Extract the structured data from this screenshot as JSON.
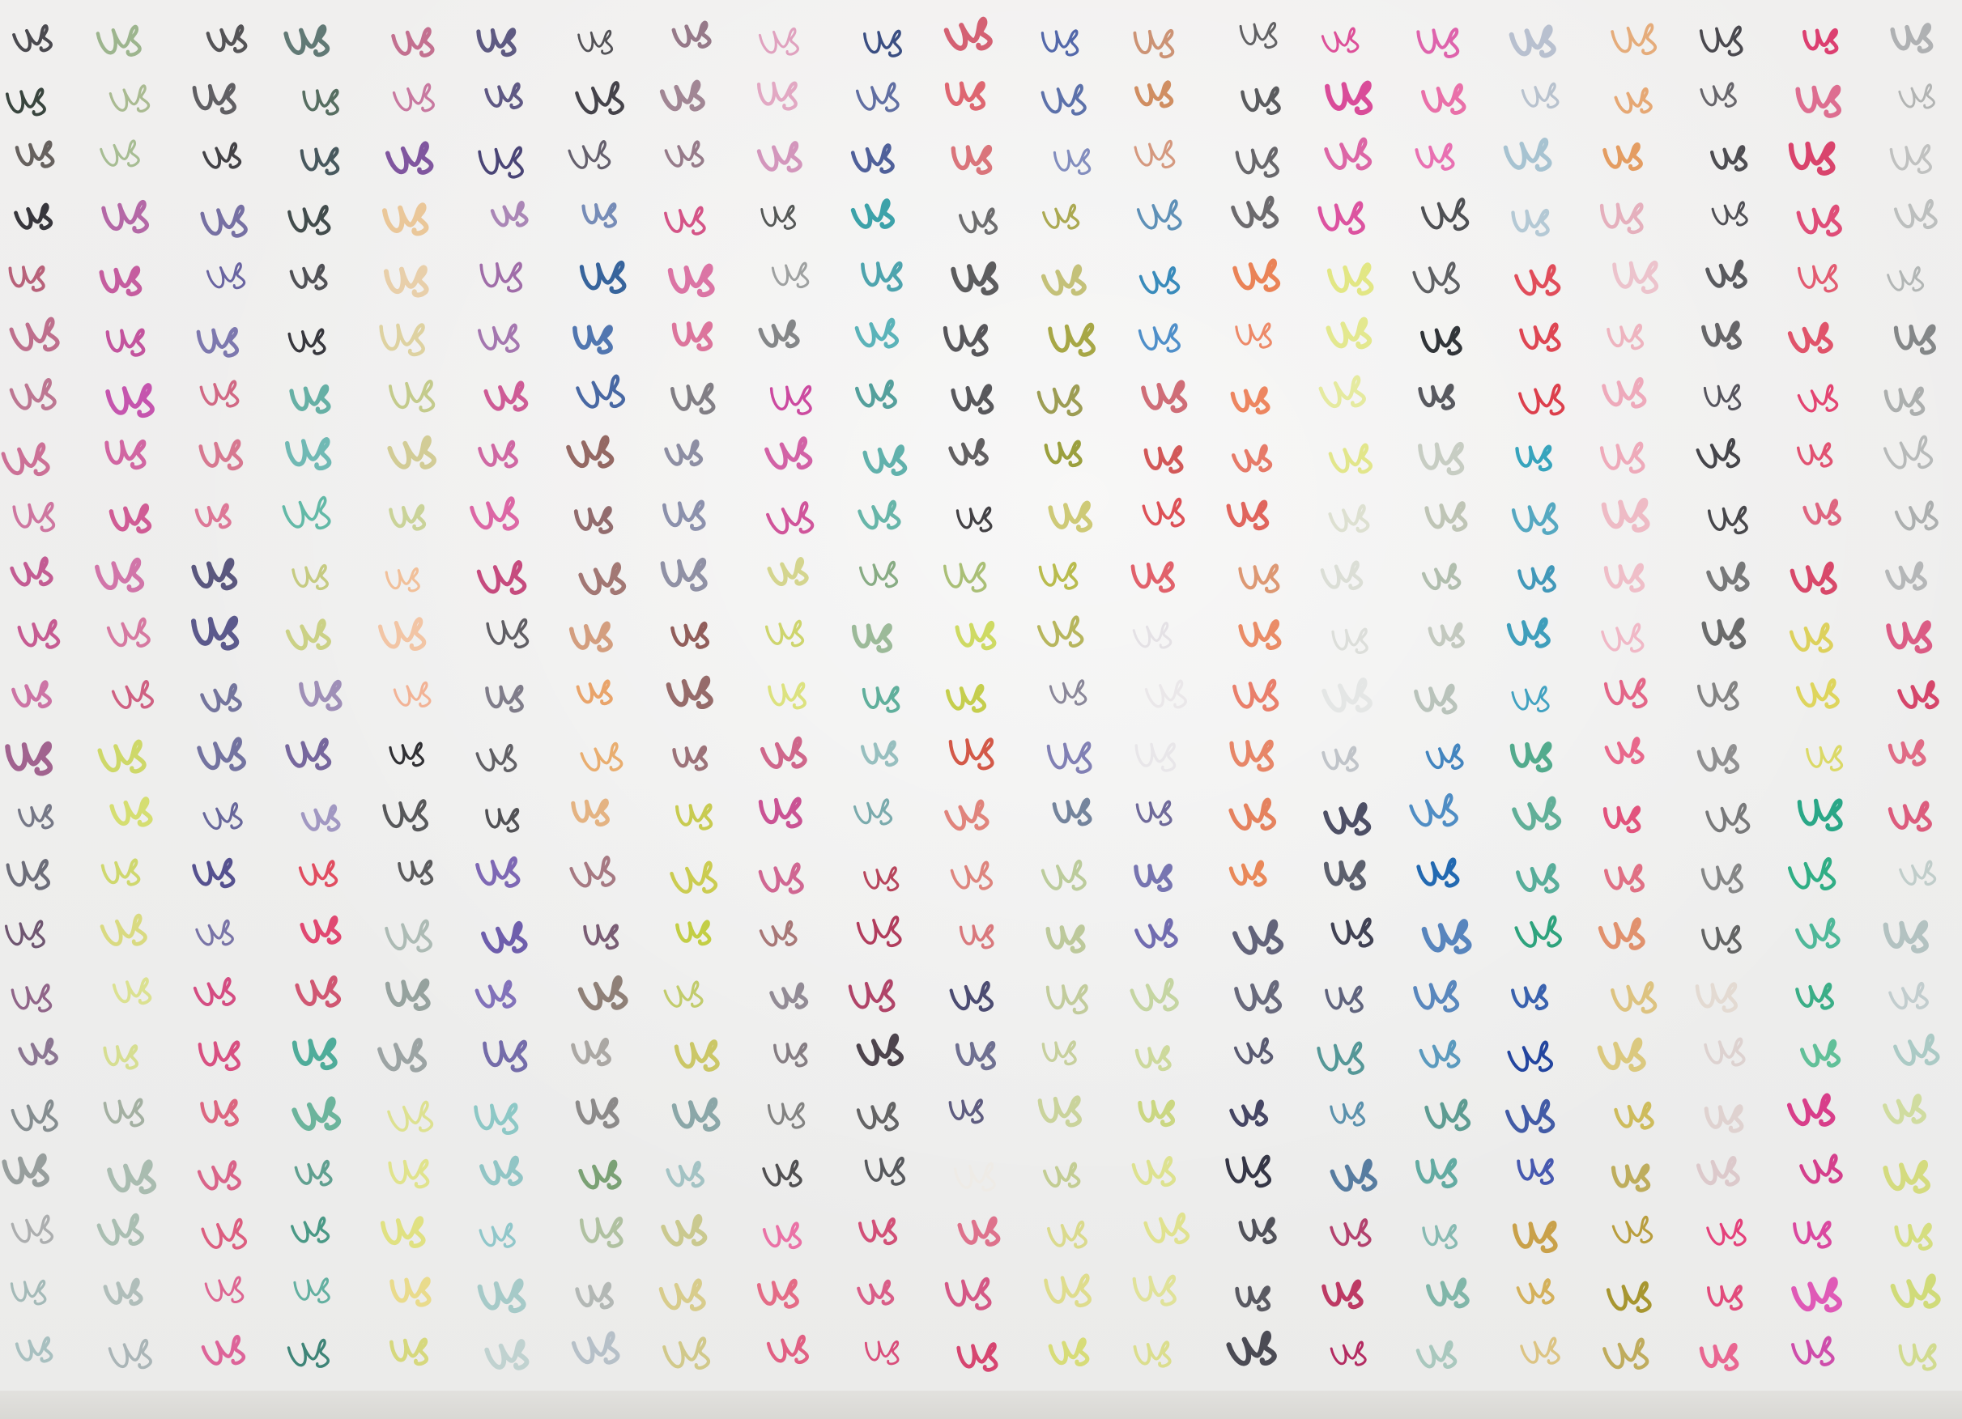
{
  "glyph_text": "Us",
  "paper": {
    "color": "#efeeed",
    "edge_color": "#dcdbd7"
  },
  "columns": [
    {
      "colors": [
        "#2e2d34",
        "#2d3a33",
        "#3b3531",
        "#35343a",
        "#b04d69",
        "#b04c72",
        "#b25d7e",
        "#c24d7f",
        "#c4548a",
        "#be4b88",
        "#c3528d",
        "#c14e8e",
        "#9d5d8a",
        "#5a5d6f",
        "#6a6b77",
        "#6f5671",
        "#8a5c83",
        "#826b8a",
        "#5f6a6d",
        "#7b8585",
        "#9da0a1",
        "#88a6a3",
        "#9bb7b7"
      ]
    },
    {
      "colors": [
        "#9bb48c",
        "#a7b98e",
        "#9db688",
        "#a84e97",
        "#c04e97",
        "#bf4797",
        "#c24cab",
        "#ca4993",
        "#cd4f8d",
        "#c84f93",
        "#cc4d85",
        "#cb5176",
        "#c8d44e",
        "#d1dc60",
        "#c9d459",
        "#d6d770",
        "#d4dd6f",
        "#d0d97a",
        "#9baa9a",
        "#9cb3a4",
        "#a9bdb1",
        "#a9b8b4",
        "#a4b0b2"
      ]
    },
    {
      "colors": [
        "#3e3e41",
        "#4b4a4e",
        "#3f3e42",
        "#4c4488",
        "#4c4690",
        "#524c97",
        "#cc5474",
        "#cf5070",
        "#d75079",
        "#535079",
        "#504e84",
        "#494a80",
        "#4c4c88",
        "#494888",
        "#524e8d",
        "#5e5896",
        "#d3447c",
        "#d64478",
        "#d94c6b",
        "#d33d6d",
        "#d9476d",
        "#da4f82",
        "#da4f8c"
      ]
    },
    {
      "colors": [
        "#2f4f4a",
        "#375345",
        "#3d4f55",
        "#2f3a3a",
        "#25262c",
        "#35353b",
        "#389b8c",
        "#3ea49c",
        "#2fa58c",
        "#bec46f",
        "#c7cd7b",
        "#7f69a2",
        "#6f5f98",
        "#8d82b6",
        "#e0495d",
        "#e04871",
        "#cf4f6c",
        "#43a793",
        "#42a182",
        "#3a8b77",
        "#2f8a76",
        "#3b9d8a",
        "#287768"
      ]
    },
    {
      "colors": [
        "#b44872",
        "#ba5285",
        "#7b4f9b",
        "#e9c391",
        "#e4c28f",
        "#d7c785",
        "#b7c070",
        "#cfc98f",
        "#bdc97d",
        "#f0b98f",
        "#f2be98",
        "#f2a07a",
        "#2c2c30",
        "#28292c",
        "#2a2a2c",
        "#9aaca4",
        "#8d9a95",
        "#9ba3a3",
        "#d9de7d",
        "#dcdf6e",
        "#dfe07a",
        "#e8d87a",
        "#d2d46c"
      ]
    },
    {
      "colors": [
        "#423d6c",
        "#41396d",
        "#403b6f",
        "#8f5fa0",
        "#8c4e98",
        "#874997",
        "#c84587",
        "#c43c8a",
        "#d63d8e",
        "#c5497c",
        "#5b595f",
        "#605c6d",
        "#3f3d45",
        "#3a3a3e",
        "#5b3fa2",
        "#5d4ba4",
        "#5e48a8",
        "#493e92",
        "#87c6c3",
        "#86c0c0",
        "#8bc5c8",
        "#a3c8c6",
        "#afc8c6"
      ]
    },
    {
      "colors": [
        "#3c3b41",
        "#3f3d44",
        "#463f4f",
        "#5370a6",
        "#2f5e98",
        "#3a64a6",
        "#3a5d9d",
        "#8a5a55",
        "#8a6264",
        "#8c5551",
        "#ce8f6b",
        "#e89f62",
        "#e7a560",
        "#df9f5e",
        "#a1727b",
        "#75576f",
        "#88776e",
        "#a5a29d",
        "#6b6868",
        "#5f8f57",
        "#a6ba95",
        "#a4aaa6",
        "#b1bcc4"
      ]
    },
    {
      "colors": [
        "#7e5b6f",
        "#8c6a7d",
        "#755165",
        "#d35185",
        "#d4528f",
        "#d65788",
        "#6d6a72",
        "#6c6f8a",
        "#7a80a1",
        "#6a6b87",
        "#8f5a57",
        "#8a5a59",
        "#8b5962",
        "#c3c63f",
        "#c7c83f",
        "#c0cb38",
        "#b6c34b",
        "#c6c254",
        "#8aa6a7",
        "#9fc1c2",
        "#c3c27d",
        "#d1c36f",
        "#cbc073"
      ]
    },
    {
      "colors": [
        "#db8ab0",
        "#dd93b6",
        "#cf8cb6",
        "#505352",
        "#858989",
        "#838587",
        "#c42c91",
        "#c6318c",
        "#c5247f",
        "#c7c967",
        "#cdd46b",
        "#d6dd62",
        "#c84c77",
        "#c6438b",
        "#c8487c",
        "#a36f6e",
        "#7d7480",
        "#6d626a",
        "#5c5c5a",
        "#4b4a4c",
        "#e94d91",
        "#e24a6b",
        "#df436e"
      ]
    },
    {
      "colors": [
        "#3a4e82",
        "#3f5190",
        "#465795",
        "#2b9aa3",
        "#2a929f",
        "#2a9ea5",
        "#2f8d88",
        "#3ca09a",
        "#48a798",
        "#84a980",
        "#7fa77b",
        "#49a48e",
        "#82b3b3",
        "#78a9ab",
        "#af2f49",
        "#ab2c4f",
        "#a72e56",
        "#382e38",
        "#2e2e31",
        "#2d2f34",
        "#cd3664",
        "#d4386d",
        "#d74071"
      ]
    },
    {
      "colors": [
        "#cd3f55",
        "#d94754",
        "#d14e57",
        "#3d3d40",
        "#3c3c3e",
        "#3c3b40",
        "#4a4a4e",
        "#3f3d3f",
        "#373539",
        "#97b256",
        "#c3d33c",
        "#c4cd4b",
        "#d04f3d",
        "#d95a50",
        "#d75e55",
        "#d2565b",
        "#3f4068",
        "#444571",
        "#48466f",
        "#eeeae5",
        "#d94568",
        "#d24b7d",
        "#d5416d"
      ]
    },
    {
      "colors": [
        "#4d63a7",
        "#596ea8",
        "#6b78b3",
        "#a3a140",
        "#b2ad49",
        "#a2a23a",
        "#88882d",
        "#9ba03e",
        "#bfba4a",
        "#b8bb4a",
        "#b5b458",
        "#6f6c82",
        "#6c6ba8",
        "#687995",
        "#b1c58b",
        "#bbc798",
        "#bac58d",
        "#bfca8e",
        "#c0cb86",
        "#b4c176",
        "#d7d77b",
        "#dcda7e",
        "#d5da6e"
      ]
    },
    {
      "colors": [
        "#c37d57",
        "#cc8656",
        "#cb7d5c",
        "#2c6fa3",
        "#2e85b7",
        "#3a82c4",
        "#cc6570",
        "#d04f4f",
        "#dc4e54",
        "#dd4652",
        "#e2dfe3",
        "#e6e3e5",
        "#e3e1e5",
        "#5e598f",
        "#5a58a1",
        "#5b55a5",
        "#bccf92",
        "#c5d48a",
        "#c9d57d",
        "#d6dd6e",
        "#dde07c",
        "#dbde80",
        "#d8dc85"
      ]
    },
    {
      "colors": [
        "#3c3c40",
        "#38393d",
        "#3d3c43",
        "#3d3c40",
        "#e8703d",
        "#ec7d58",
        "#ec8159",
        "#e36753",
        "#e0635b",
        "#d98a5f",
        "#e87a4f",
        "#e65f46",
        "#e36239",
        "#e26b40",
        "#e7743b",
        "#4d4e69",
        "#3e4058",
        "#43445e",
        "#464664",
        "#2e2f40",
        "#3a3b44",
        "#373843",
        "#33333d"
      ]
    },
    {
      "colors": [
        "#d8368b",
        "#d5348c",
        "#d4348b",
        "#d7308e",
        "#e0e57b",
        "#e0e680",
        "#dfe683",
        "#e0e484",
        "#dcdfcf",
        "#d9dcd3",
        "#dadcd8",
        "#dfe1e0",
        "#b6bbc0",
        "#3d3f57",
        "#3f4454",
        "#3d3e51",
        "#474c6a",
        "#3d8a8a",
        "#3a7c9d",
        "#2f5e8c",
        "#ac2d5e",
        "#b92a58",
        "#b1275e"
      ]
    },
    {
      "colors": [
        "#db4ea2",
        "#e96ea8",
        "#e75ba8",
        "#2e3136",
        "#2f3236",
        "#2f3337",
        "#2e2f36",
        "#bac2b5",
        "#b4bcaa",
        "#b0bdad",
        "#b6beb1",
        "#b4bfb6",
        "#2a75b7",
        "#2171b7",
        "#1f67b0",
        "#2862ad",
        "#2463ac",
        "#297dae",
        "#4c9287",
        "#5ba89e",
        "#68aaa0",
        "#7fb5a8",
        "#9ec2b7"
      ]
    },
    {
      "colors": [
        "#a6b1c4",
        "#a9b5c5",
        "#8fb4c7",
        "#9ebacb",
        "#dd2f3f",
        "#db3341",
        "#db3946",
        "#1f9ab6",
        "#1e8db0",
        "#2d8eb3",
        "#2b95b5",
        "#2093b8",
        "#2e9a75",
        "#4fa68c",
        "#4aa793",
        "#27a079",
        "#1b49a3",
        "#1c3f9c",
        "#1f3d98",
        "#1e35a1",
        "#c9a14a",
        "#d2ad52",
        "#d5b45c"
      ]
    },
    {
      "colors": [
        "#e1924e",
        "#e28f4b",
        "#e29352",
        "#e4aebc",
        "#eab8c3",
        "#eda1b0",
        "#eda5b7",
        "#ee9eb1",
        "#edb5c0",
        "#eeb6c1",
        "#efafbf",
        "#de3361",
        "#e64370",
        "#df3c6c",
        "#dc536b",
        "#e08c67",
        "#d9bb6c",
        "#d8c36e",
        "#c7b13c",
        "#b39e3c",
        "#b3962c",
        "#a39126",
        "#ae9429"
      ]
    },
    {
      "colors": [
        "#3c3b41",
        "#3d3b43",
        "#403f44",
        "#3f3f45",
        "#3c3d42",
        "#434246",
        "#3f3e48",
        "#2f2f35",
        "#3c3b40",
        "#5c5d5e",
        "#5e5f60",
        "#616162",
        "#6e6f70",
        "#6f7071",
        "#737475",
        "#575858",
        "#e1d7cf",
        "#dcd0cd",
        "#dbcbc9",
        "#d9c3c5",
        "#e33c77",
        "#e13d71",
        "#e8457b"
      ]
    },
    {
      "colors": [
        "#dc3d6e",
        "#d74370",
        "#d9426a",
        "#df4b76",
        "#de3c57",
        "#dd3e58",
        "#e23e6c",
        "#de3e61",
        "#d7375b",
        "#d6395e",
        "#dbcf52",
        "#dbd147",
        "#d7d44c",
        "#1ea381",
        "#29ab81",
        "#1aa67e",
        "#2da97f",
        "#35b17e",
        "#d52c7f",
        "#d22c82",
        "#d6238f",
        "#db2ea7",
        "#c82f9f"
      ]
    },
    {
      "colors": [
        "#a3a6a8",
        "#a8acab",
        "#b0b3b2",
        "#b3b6b5",
        "#b0b4b3",
        "#7c7f80",
        "#9ea1a1",
        "#a4a8a8",
        "#9ca0a0",
        "#a5a8a9",
        "#d6376a",
        "#d33c62",
        "#da3b60",
        "#d83c64",
        "#b2c3bf",
        "#aebebd",
        "#b8c6c7",
        "#9fc3be",
        "#c9d88f",
        "#ced764",
        "#d2dc75",
        "#cfda73",
        "#c8d670"
      ]
    }
  ]
}
